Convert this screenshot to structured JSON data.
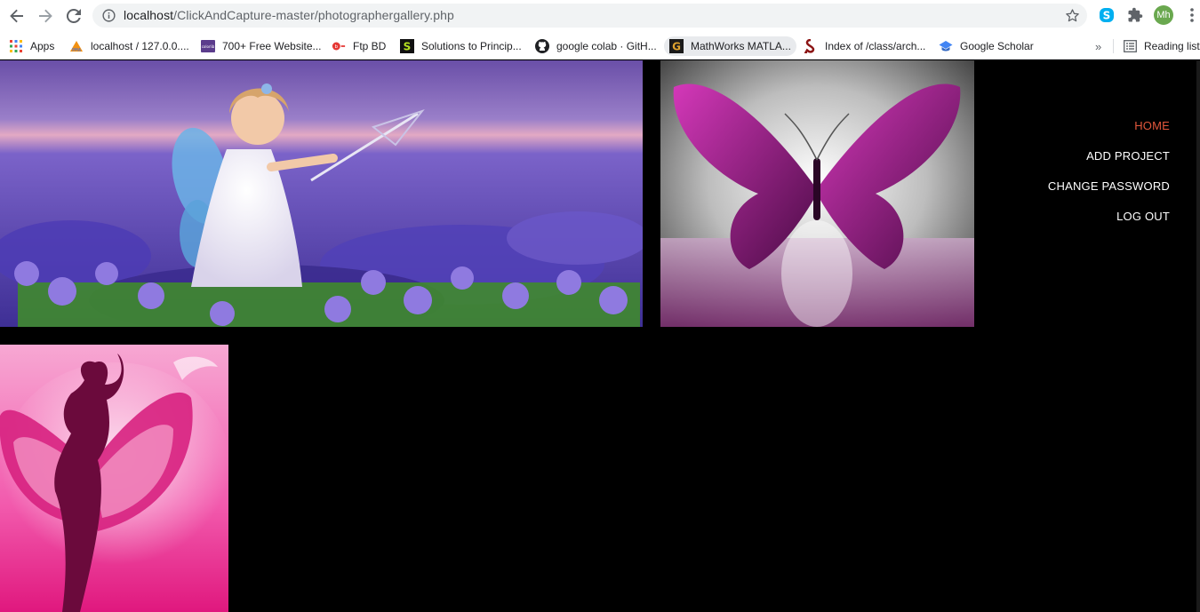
{
  "browser": {
    "url_host": "localhost",
    "url_path": "/ClickAndCapture-master/photographergallery.php",
    "avatar": "Mh",
    "icons": [
      "back-icon",
      "forward-icon",
      "reload-icon",
      "info-icon",
      "star-icon",
      "skype-icon",
      "puzzle-icon",
      "kebab-menu-icon"
    ]
  },
  "bookmarks": [
    {
      "label": "Apps"
    },
    {
      "label": "localhost / 127.0.0...."
    },
    {
      "label": "700+ Free Website..."
    },
    {
      "label": "Ftp BD"
    },
    {
      "label": "Solutions to Princip..."
    },
    {
      "label": "google colab · GitH..."
    },
    {
      "label": "MathWorks MATLA..."
    },
    {
      "label": "Index of /class/arch..."
    },
    {
      "label": "Google Scholar"
    }
  ],
  "reading_list": "Reading list",
  "menu": {
    "home": "HOME",
    "add_project": "ADD PROJECT",
    "change_password": "CHANGE PASSWORD",
    "log_out": "LOG OUT"
  },
  "colors": {
    "accent": "#e2573c",
    "page_bg": "#000000"
  }
}
